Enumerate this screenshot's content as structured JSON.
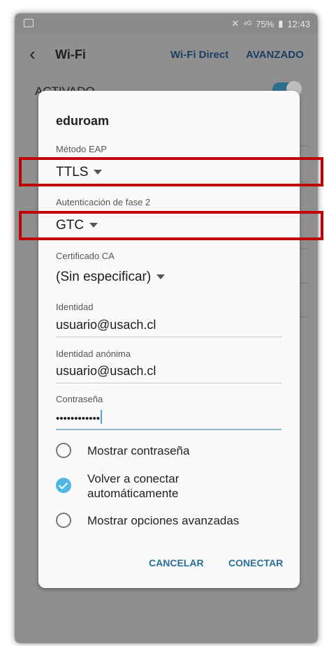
{
  "status_bar": {
    "signal_text": "⁴ᴳ",
    "battery": "75%",
    "time": "12:43"
  },
  "app_bar": {
    "title": "Wi-Fi",
    "wifi_direct": "Wi-Fi Direct",
    "advanced": "AVANZADO"
  },
  "background": {
    "activado_label": "ACTIVADO"
  },
  "dialog": {
    "network_name": "eduroam",
    "eap_label": "Método EAP",
    "eap_value": "TTLS",
    "phase2_label": "Autenticación de fase 2",
    "phase2_value": "GTC",
    "ca_label": "Certificado CA",
    "ca_value": "(Sin especificar)",
    "identity_label": "Identidad",
    "identity_value": "usuario@usach.cl",
    "anon_label": "Identidad anónima",
    "anon_value": "usuario@usach.cl",
    "password_label": "Contraseña",
    "password_value": "••••••••••••",
    "options": {
      "show_password": "Mostrar contraseña",
      "reconnect": "Volver a conectar automáticamente",
      "advanced": "Mostrar opciones avanzadas"
    },
    "options_state": {
      "show_password": false,
      "reconnect": true,
      "advanced": false
    },
    "cancel": "CANCELAR",
    "connect": "CONECTAR"
  },
  "colors": {
    "accent": "#2a6f9a",
    "check": "#4fb6e6",
    "highlight": "#c00000"
  }
}
